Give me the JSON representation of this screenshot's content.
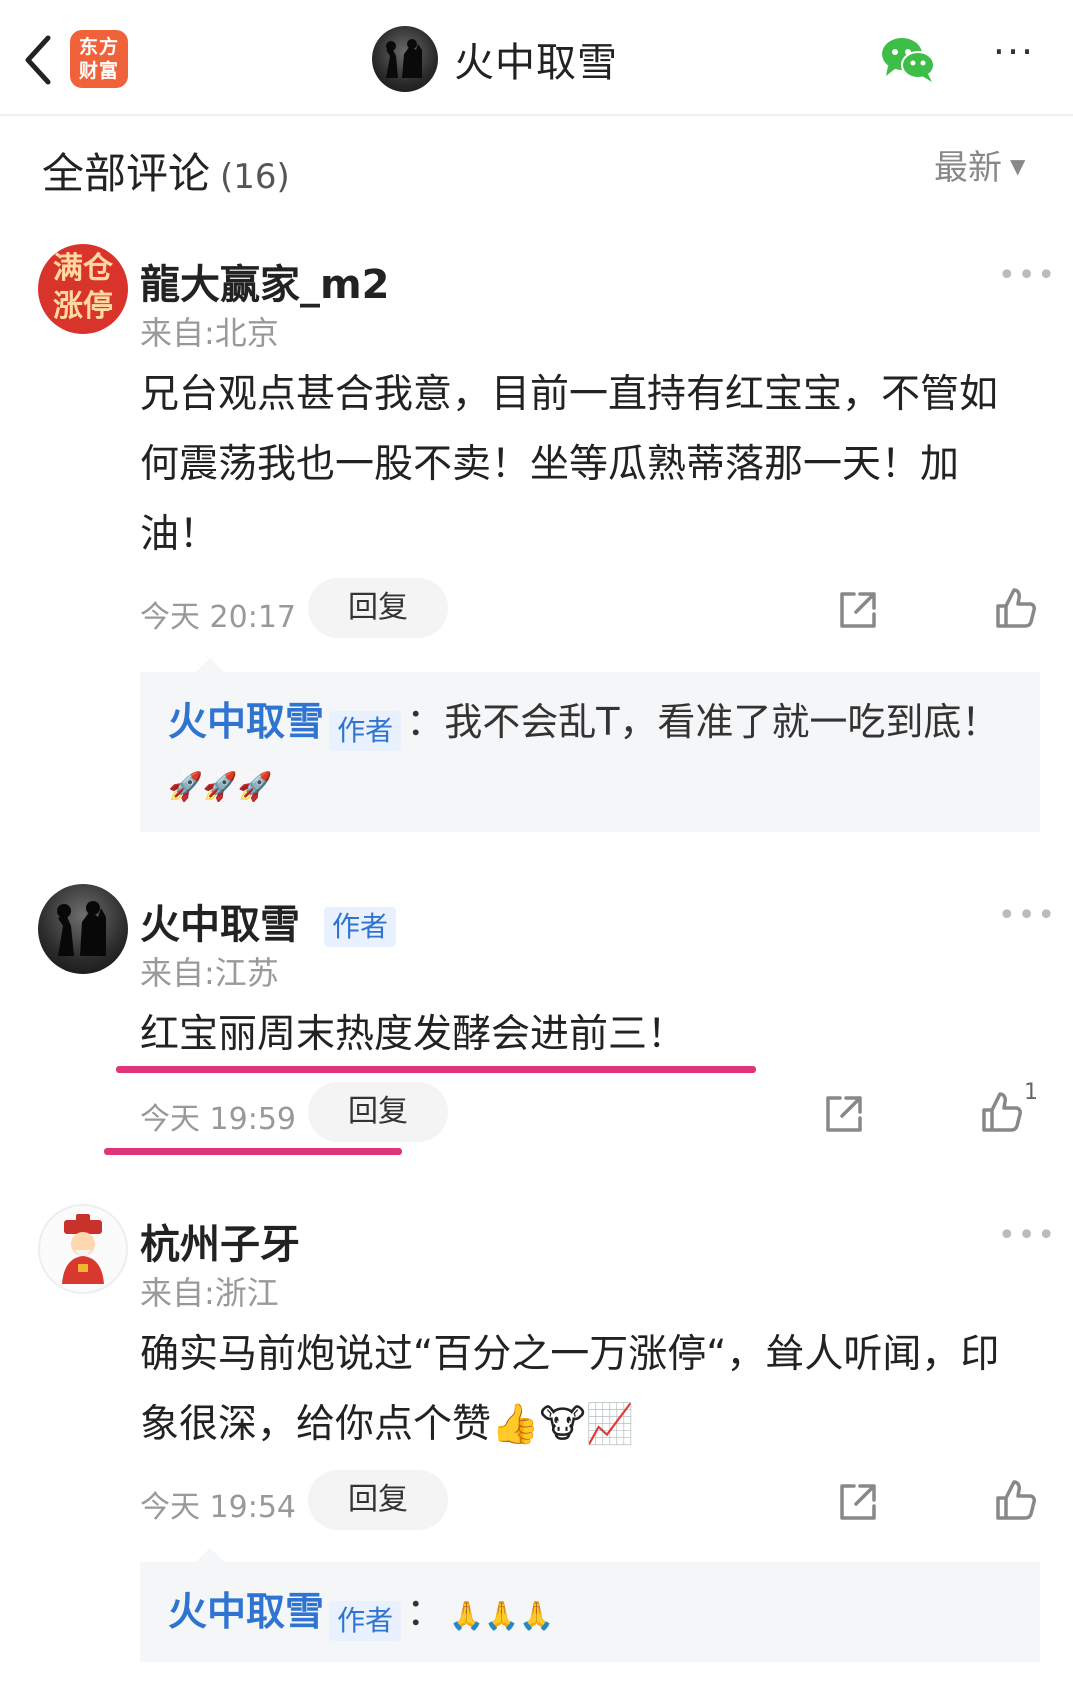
{
  "header": {
    "brand_line1": "东方",
    "brand_line2": "财富",
    "title": "火中取雪",
    "back_icon": "chevron-left-icon",
    "share_icon": "wechat-icon",
    "more_label": "···"
  },
  "comments_header": {
    "title": "全部评论",
    "count": "(16)",
    "sort_label": "最新",
    "sort_arrow": "▼"
  },
  "comments": [
    {
      "user": "龍大赢家_m2",
      "avatar_text": "满仓涨停",
      "location": "来自:北京",
      "text": "兄台观点甚合我意，目前一直持有红宝宝，不管如何震荡我也一股不卖！坐等瓜熟蒂落那一天！加油！",
      "time": "今天 20:17",
      "reply_label": "回复",
      "reply": {
        "author": "火中取雪",
        "badge": "作者",
        "text": "：我不会乱T，看准了就一吃到底！",
        "emoji": "🚀🚀🚀"
      }
    },
    {
      "user": "火中取雪",
      "badge": "作者",
      "location": "来自:江苏",
      "text": "红宝丽周末热度发酵会进前三！",
      "time": "今天 19:59",
      "reply_label": "回复",
      "likes": "1"
    },
    {
      "user": "杭州子牙",
      "location": "来自:浙江",
      "text": "确实马前炮说过“百分之一万涨停“，耸人听闻，印象很深，给你点个赞👍🐮📈",
      "time": "今天 19:54",
      "reply_label": "回复",
      "reply": {
        "author": "火中取雪",
        "badge": "作者",
        "text": "：",
        "emoji": "🙏🙏🙏"
      }
    }
  ],
  "colors": {
    "brand": "#f0623a",
    "link": "#2f74d0",
    "highlight": "#e0357a"
  }
}
